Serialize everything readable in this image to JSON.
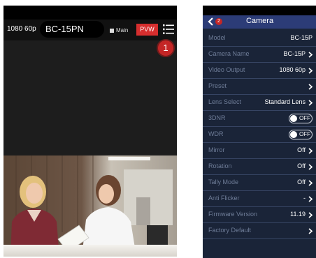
{
  "left_app": {
    "resolution": "1080 60p",
    "camera_name": "BC-15PN",
    "main_label": "Main",
    "pvw_label": "PVW",
    "menu_icon": "hamburger-menu-icon",
    "callout": "1"
  },
  "right_app": {
    "title": "Camera",
    "back_badge": "2",
    "rows": [
      {
        "label": "Model",
        "value": "BC-15P",
        "type": "text"
      },
      {
        "label": "Camera Name",
        "value": "BC-15P",
        "type": "nav"
      },
      {
        "label": "Video Output",
        "value": "1080 60p",
        "type": "nav"
      },
      {
        "label": "Preset",
        "value": "",
        "type": "nav"
      },
      {
        "label": "Lens Select",
        "value": "Standard Lens",
        "type": "nav"
      },
      {
        "label": "3DNR",
        "value": "OFF",
        "type": "toggle"
      },
      {
        "label": "WDR",
        "value": "OFF",
        "type": "toggle"
      },
      {
        "label": "Mirror",
        "value": "Off",
        "type": "nav"
      },
      {
        "label": "Rotation",
        "value": "Off",
        "type": "nav"
      },
      {
        "label": "Tally Mode",
        "value": "Off",
        "type": "nav"
      },
      {
        "label": "Anti Flicker",
        "value": "-",
        "type": "nav"
      },
      {
        "label": "Firmware Version",
        "value": "11.19",
        "type": "nav"
      },
      {
        "label": "Factory Default",
        "value": "",
        "type": "nav"
      }
    ]
  },
  "colors": {
    "pvw_red": "#d62e2e",
    "badge_red": "#c42626",
    "header_blue": "#2c3c77",
    "panel_navy": "#1a2438",
    "label_gray": "#6e7c97"
  }
}
